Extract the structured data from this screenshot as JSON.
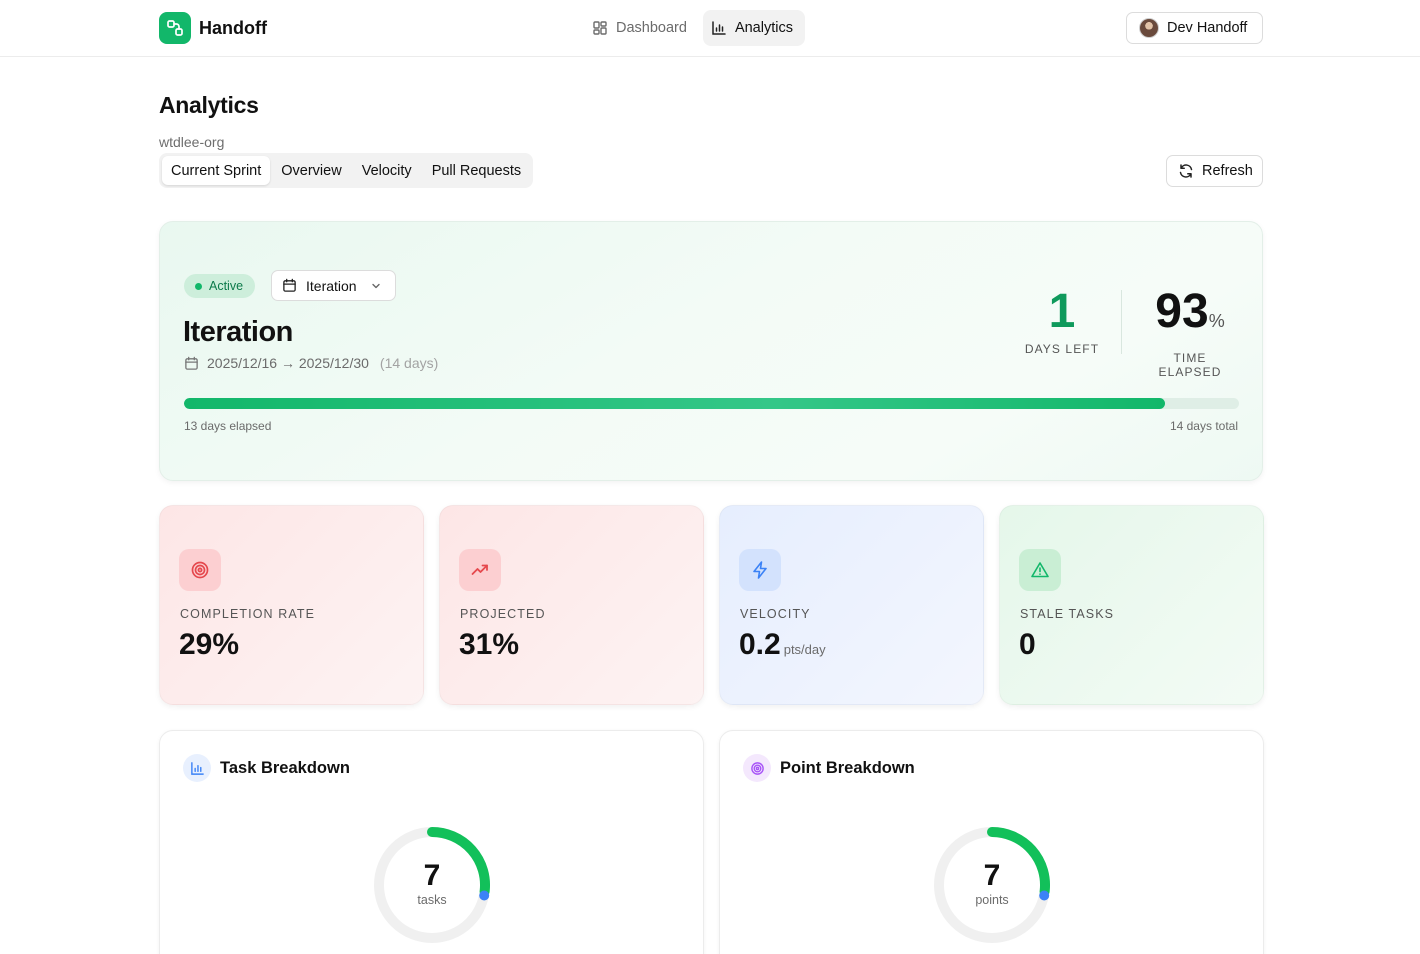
{
  "app": {
    "name": "Handoff",
    "nav": [
      {
        "label": "Dashboard",
        "icon": "dashboard-grid-icon",
        "active": false
      },
      {
        "label": "Analytics",
        "icon": "bar-chart-icon",
        "active": true
      }
    ],
    "user": {
      "name": "Dev Handoff"
    }
  },
  "page": {
    "title": "Analytics",
    "org": "wtdlee-org",
    "tabs": [
      {
        "label": "Current Sprint",
        "active": true
      },
      {
        "label": "Overview",
        "active": false
      },
      {
        "label": "Velocity",
        "active": false
      },
      {
        "label": "Pull Requests",
        "active": false
      }
    ],
    "refresh_label": "Refresh"
  },
  "sprint": {
    "status": "Active",
    "selector_value": "Iteration",
    "name": "Iteration",
    "date_range": "2025/12/16 → 2025/12/30",
    "duration": "(14 days)",
    "days_left": "1",
    "days_left_label": "DAYS LEFT",
    "time_elapsed": "93",
    "time_elapsed_unit": "%",
    "time_elapsed_label": "TIME ELAPSED",
    "progress_fraction": 0.93,
    "elapsed_text": "13 days elapsed",
    "total_text": "14 days total"
  },
  "metrics": [
    {
      "label": "COMPLETION RATE",
      "value": "29%",
      "unit": "",
      "icon": "target-icon",
      "accent": "#e5484d"
    },
    {
      "label": "PROJECTED",
      "value": "31%",
      "unit": "",
      "icon": "trending-up-icon",
      "accent": "#e5484d"
    },
    {
      "label": "VELOCITY",
      "value": "0.2",
      "unit": "pts/day",
      "icon": "lightning-icon",
      "accent": "#3b82f6"
    },
    {
      "label": "STALE TASKS",
      "value": "0",
      "unit": "",
      "icon": "warning-triangle-icon",
      "accent": "#12b76a"
    }
  ],
  "breakdowns": [
    {
      "title": "Task Breakdown",
      "icon": "bar-chart-icon",
      "total": "7",
      "unit": "tasks"
    },
    {
      "title": "Point Breakdown",
      "icon": "target-icon",
      "total": "7",
      "unit": "points"
    }
  ],
  "colors": {
    "brand": "#12b76a",
    "accent_green": "#0f9a5c",
    "accent_red": "#e5484d",
    "accent_blue": "#3b82f6",
    "accent_purple": "#a855f7",
    "donut_track": "#f0f0f0"
  }
}
